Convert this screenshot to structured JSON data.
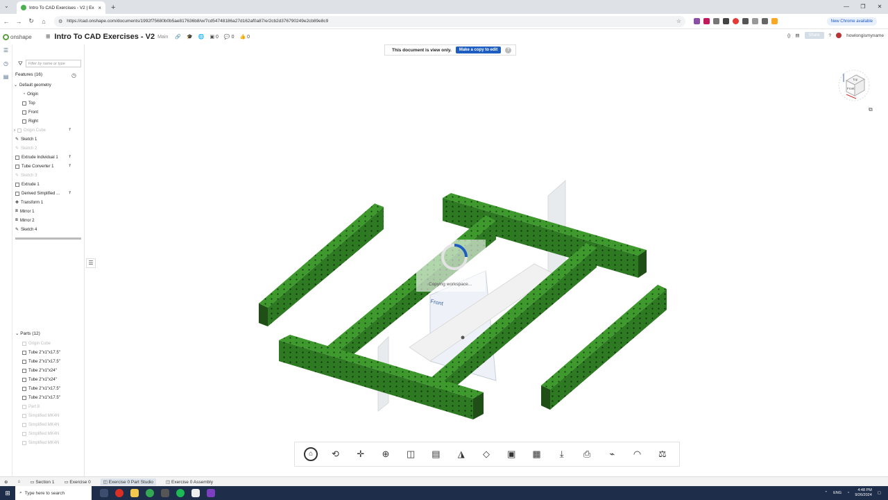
{
  "browser": {
    "tab_title": "Intro To CAD Exercises - V2 | Ex",
    "url": "https://cad.onshape.com/documents/1992f75680b0b5ae817636b8/w/7cd54748186a27d162af0a87/e/2cb2d376790249e2cb89e8c9",
    "new_chrome": "New Chrome available"
  },
  "header": {
    "logo": "onshape",
    "title": "Intro To CAD Exercises - V2",
    "branch": "Main",
    "count1": "0",
    "count2": "0",
    "count3": "0",
    "share": "Share",
    "user": "howlongismyname"
  },
  "banner": {
    "text": "This document is view only.",
    "button": "Make a copy to edit"
  },
  "features": {
    "filter_placeholder": "Filter by name or type",
    "heading": "Features (16)",
    "items": [
      {
        "label": "Default geometry",
        "dim": false
      },
      {
        "label": "Origin",
        "dim": false
      },
      {
        "label": "Top",
        "dim": false
      },
      {
        "label": "Front",
        "dim": false
      },
      {
        "label": "Right",
        "dim": false
      },
      {
        "label": "Origin Cube",
        "dim": true
      },
      {
        "label": "Sketch 1",
        "dim": false
      },
      {
        "label": "Sketch 2",
        "dim": true
      },
      {
        "label": "Extrude Individual 1",
        "dim": false
      },
      {
        "label": "Tube Converter 1",
        "dim": false
      },
      {
        "label": "Sketch 3",
        "dim": true
      },
      {
        "label": "Extrude 1",
        "dim": false
      },
      {
        "label": "Derived Simplified ...",
        "dim": false
      },
      {
        "label": "Transform 1",
        "dim": false
      },
      {
        "label": "Mirror 1",
        "dim": false
      },
      {
        "label": "Mirror 2",
        "dim": false
      },
      {
        "label": "Sketch 4",
        "dim": false
      }
    ]
  },
  "parts": {
    "heading": "Parts (12)",
    "items": [
      {
        "label": "Origin Cube",
        "dim": true
      },
      {
        "label": "Tube 2\"x1\"x17.5\"",
        "dim": false
      },
      {
        "label": "Tube 2\"x1\"x17.5\"",
        "dim": false
      },
      {
        "label": "Tube 2\"x1\"x24\"",
        "dim": false
      },
      {
        "label": "Tube 2\"x1\"x24\"",
        "dim": false
      },
      {
        "label": "Tube 2\"x1\"x17.5\"",
        "dim": false
      },
      {
        "label": "Tube 2\"x1\"x17.5\"",
        "dim": false
      },
      {
        "label": "Part 8",
        "dim": true
      },
      {
        "label": "Simplified MK4N",
        "dim": true
      },
      {
        "label": "Simplified MK4N",
        "dim": true
      },
      {
        "label": "Simplified MK4N",
        "dim": true
      },
      {
        "label": "Simplified MK4N",
        "dim": true
      }
    ]
  },
  "viewport": {
    "loading_text": "Copying workspace...",
    "plane_label": "Front",
    "cube_top": "Top",
    "cube_front": "Front"
  },
  "bottom_tabs": {
    "t1": "Section 1",
    "t2": "Exercise 0",
    "t3": "Exercise 0 Part Studio",
    "t4": "Exercise 0 Assembly"
  },
  "taskbar": {
    "search": "Type here to search",
    "lang": "ENG",
    "time": "4:48 PM",
    "date": "9/26/2024"
  },
  "colors": {
    "tube_green": "#3f9a2e",
    "accent_blue": "#1d5dc1"
  }
}
